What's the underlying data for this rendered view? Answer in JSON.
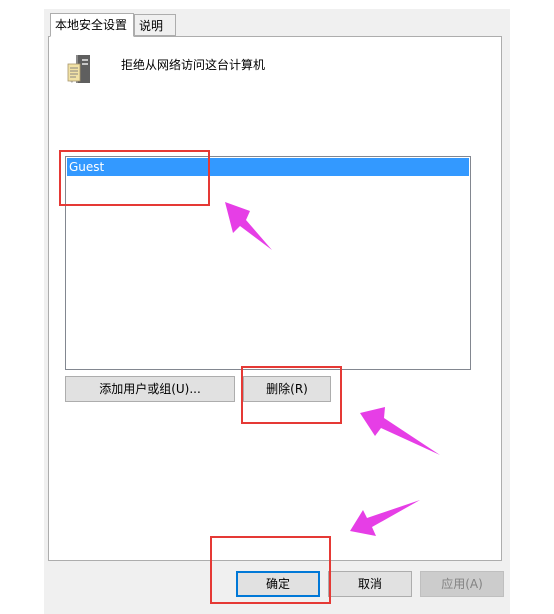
{
  "tabs": [
    {
      "label": "本地安全设置"
    },
    {
      "label": "说明"
    }
  ],
  "policy": {
    "title": "拒绝从网络访问这台计算机",
    "icon": "server-icon"
  },
  "user_list": {
    "items": [
      "Guest"
    ],
    "selected": "Guest"
  },
  "buttons": {
    "add": "添加用户或组(U)...",
    "remove": "删除(R)",
    "ok": "确定",
    "cancel": "取消",
    "apply": "应用(A)"
  },
  "colors": {
    "selection": "#3399ff",
    "annotation_box": "#e53935",
    "annotation_arrow": "#e63ee6",
    "default_button_border": "#0078d7"
  }
}
